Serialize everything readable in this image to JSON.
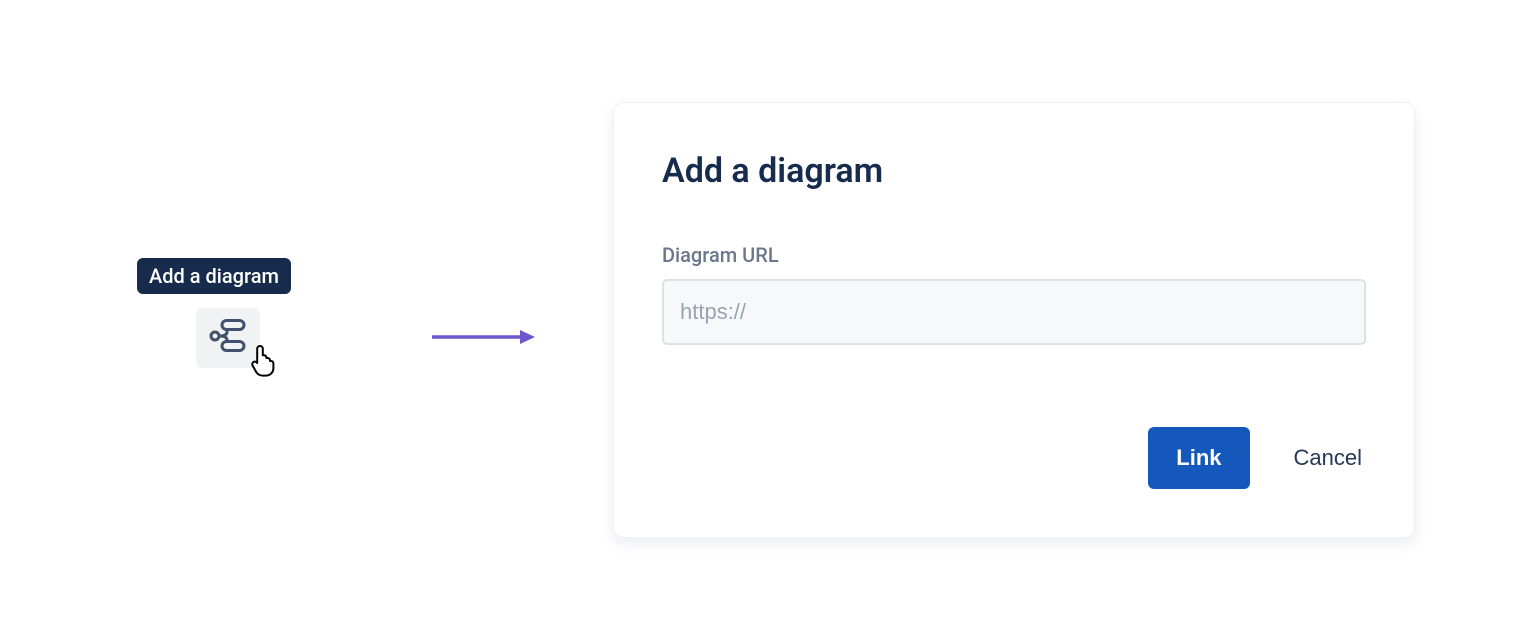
{
  "tooltip": {
    "label": "Add a diagram"
  },
  "toolbar": {
    "button_name": "add-diagram"
  },
  "modal": {
    "title": "Add a diagram",
    "field_label": "Diagram URL",
    "url_placeholder": "https://",
    "primary_button": "Link",
    "secondary_button": "Cancel"
  },
  "colors": {
    "arrow": "#6e56cf",
    "button_primary": "#1558bc",
    "tooltip_bg": "#172b4d"
  }
}
